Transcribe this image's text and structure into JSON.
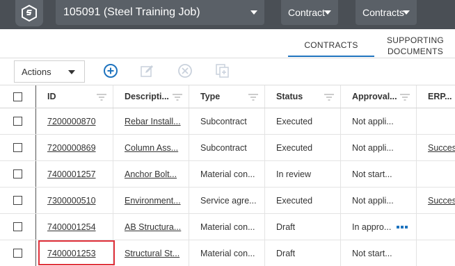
{
  "header": {
    "job": "105091 (Steel Training Job)",
    "nav_contract": "Contract",
    "nav_contracts": "Contracts"
  },
  "tabs": {
    "contracts": "CONTRACTS",
    "supporting_line1": "SUPPORTING",
    "supporting_line2": "DOCUMENTS"
  },
  "toolbar": {
    "actions_label": "Actions",
    "icons": [
      "add-circle-icon",
      "edit-icon",
      "cancel-circle-icon",
      "copy-icon"
    ],
    "accent_color": "#1e73be"
  },
  "table": {
    "columns": [
      "ID",
      "Descripti...",
      "Type",
      "Status",
      "Approval...",
      "ERP..."
    ],
    "rows": [
      {
        "id": "7200000870",
        "description": "Rebar Install...",
        "type": "Subcontract",
        "status": "Executed",
        "approval": "Not appli...",
        "erp": ""
      },
      {
        "id": "7200000869",
        "description": "Column Ass...",
        "type": "Subcontract",
        "status": "Executed",
        "approval": "Not appli...",
        "erp": "Succes"
      },
      {
        "id": "7400001257",
        "description": "Anchor Bolt...",
        "type": "Material con...",
        "status": "In review",
        "approval": "Not start...",
        "erp": ""
      },
      {
        "id": "7300000510",
        "description": "Environment...",
        "type": "Service agre...",
        "status": "Executed",
        "approval": "Not appli...",
        "erp": "Succes"
      },
      {
        "id": "7400001254",
        "description": "AB Structura...",
        "type": "Material con...",
        "status": "Draft",
        "approval": "In appro...",
        "erp": ""
      },
      {
        "id": "7400001253",
        "description": "Structural St...",
        "type": "Material con...",
        "status": "Draft",
        "approval": "Not start...",
        "erp": ""
      }
    ]
  }
}
